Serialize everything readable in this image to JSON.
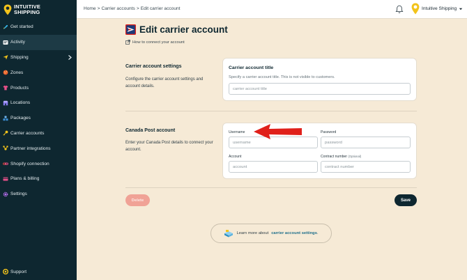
{
  "brand": {
    "line1": "INTUITIVE",
    "line2": "SHIPPING"
  },
  "sidebar": {
    "items": [
      {
        "label": "Get started",
        "icon": "rocket-icon"
      },
      {
        "label": "Activity",
        "icon": "activity-icon",
        "active": true
      },
      {
        "label": "Shipping",
        "icon": "plane-icon",
        "has_submenu": true
      },
      {
        "label": "Zones",
        "icon": "globe-icon"
      },
      {
        "label": "Products",
        "icon": "shirt-icon"
      },
      {
        "label": "Locations",
        "icon": "store-icon"
      },
      {
        "label": "Packages",
        "icon": "boxes-icon"
      },
      {
        "label": "Carrier accounts",
        "icon": "key-icon"
      },
      {
        "label": "Partner integrations",
        "icon": "integrations-icon"
      },
      {
        "label": "Shopify connection",
        "icon": "link-icon"
      },
      {
        "label": "Plans & billing",
        "icon": "billing-icon"
      },
      {
        "label": "Settings",
        "icon": "gear-icon"
      }
    ],
    "support": "Support"
  },
  "header": {
    "breadcrumb": [
      "Home",
      "Carrier accounts",
      "Edit carrier account"
    ],
    "separator": ">",
    "account_name": "Intuitive Shipping"
  },
  "page": {
    "title": "Edit carrier account",
    "howto_link": "How to connect your account"
  },
  "settings_section": {
    "heading": "Carrier account settings",
    "description": "Configure the carrier account settings and account details.",
    "card_title": "Carrier account title",
    "card_help": "Specify a carrier account title. This is not visible to customers.",
    "title_input": {
      "value": "",
      "placeholder": "carrier account title"
    }
  },
  "canada_post_section": {
    "heading": "Canada Post account",
    "description": "Enter your Canada Post details to connect your account.",
    "fields": {
      "username": {
        "label": "Username",
        "value": "",
        "placeholder": "username"
      },
      "password": {
        "label": "Password",
        "value": "",
        "placeholder": "password"
      },
      "account": {
        "label": "Account",
        "value": "",
        "placeholder": "account"
      },
      "contract": {
        "label": "Contract number",
        "optional": "(Optional)",
        "value": "",
        "placeholder": "contract number"
      }
    }
  },
  "actions": {
    "delete_label": "Delete",
    "save_label": "Save"
  },
  "learn_more": {
    "prefix": "Learn more about",
    "link": "carrier account settings",
    "suffix": "."
  },
  "colors": {
    "sidebar_bg": "#0e2730",
    "page_bg": "#f6ead6",
    "accent_red": "#e0201a",
    "save_bg": "#0e2730",
    "delete_bg": "#f0a296",
    "link": "#1f6f8b"
  }
}
